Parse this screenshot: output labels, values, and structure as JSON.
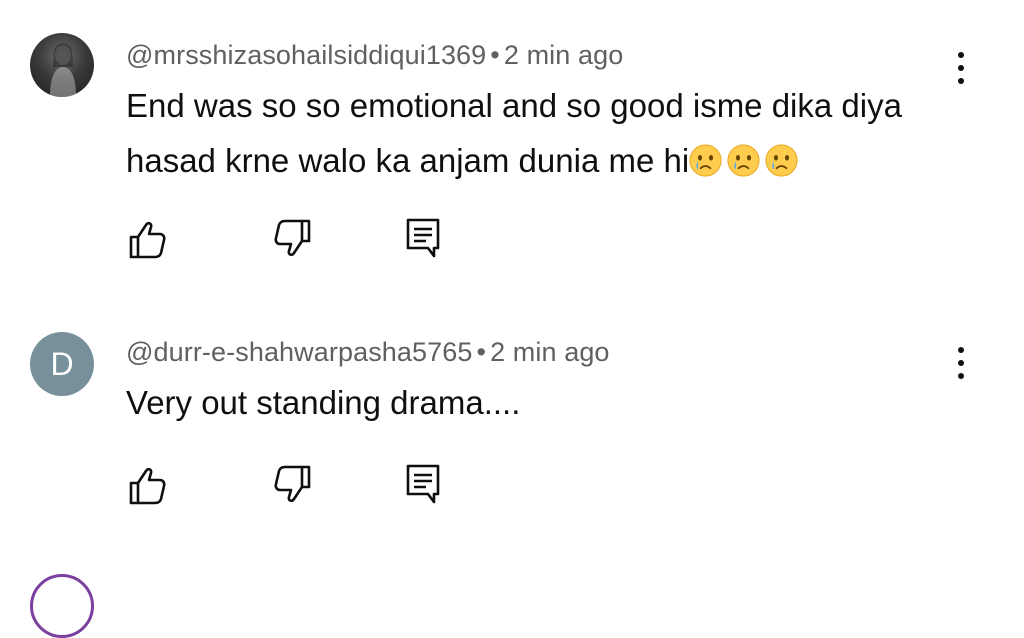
{
  "comments": [
    {
      "handle": "@mrsshizasohailsiddiqui1369",
      "separator": "•",
      "time": "2 min ago",
      "text_line1": "End was so so emotional and so good isme dika diya",
      "text_line2": "hasad krne walo ka anjam dunia me hi",
      "emojis": [
        "crying-face-emoji",
        "crying-face-emoji",
        "crying-face-emoji"
      ],
      "avatar": "profile-photo"
    },
    {
      "handle": "@durr-e-shahwarpasha5765",
      "separator": "•",
      "time": "2 min ago",
      "text_line1": "Very out standing drama....",
      "avatar_letter": "D",
      "avatar_color": "#78909c"
    }
  ],
  "icons": {
    "like": "thumbs-up-icon",
    "dislike": "thumbs-down-icon",
    "reply": "reply-comment-icon",
    "more": "more-vertical-icon"
  }
}
